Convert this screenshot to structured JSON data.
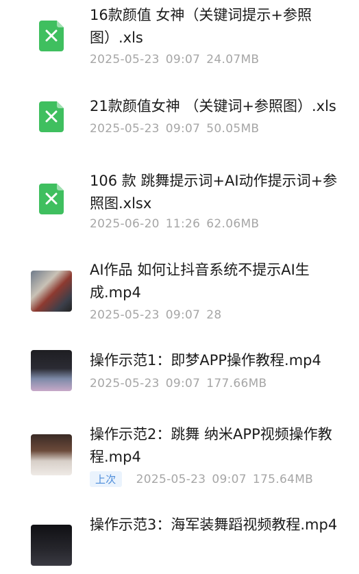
{
  "files": [
    {
      "type": "xls",
      "icon": "excel-file-icon",
      "name": "16款颜值 女神（关键词提示+参照图）.xls",
      "date": "2025-05-23",
      "time": "09:07",
      "size": "24.07MB"
    },
    {
      "type": "xls",
      "icon": "excel-file-icon",
      "name": "21款颜值女神 （关键词+参照图）.xls",
      "date": "2025-05-23",
      "time": "09:07",
      "size": "50.05MB"
    },
    {
      "type": "xls",
      "icon": "excel-file-icon",
      "name": "106 款 跳舞提示词+AI动作提示词+参照图.xlsx",
      "date": "2025-06-20",
      "time": "11:26",
      "size": "62.06MB"
    },
    {
      "type": "video",
      "icon": "video-thumbnail",
      "name": "AI作品 如何让抖音系统不提示AI生成.mp4",
      "date": "2025-05-23",
      "time": "09:07",
      "size": "28"
    },
    {
      "type": "video",
      "icon": "video-thumbnail",
      "name": "操作示范1：即梦APP操作教程.mp4",
      "date": "2025-05-23",
      "time": "09:07",
      "size": "177.66MB"
    },
    {
      "type": "video",
      "icon": "video-thumbnail",
      "name": "操作示范2：跳舞 纳米APP视频操作教程.mp4",
      "badge": "上次",
      "date": "2025-05-23",
      "time": "09:07",
      "size": "175.64MB"
    },
    {
      "type": "video",
      "icon": "video-thumbnail",
      "name": "操作示范3：海军装舞蹈视频教程.mp4"
    }
  ]
}
